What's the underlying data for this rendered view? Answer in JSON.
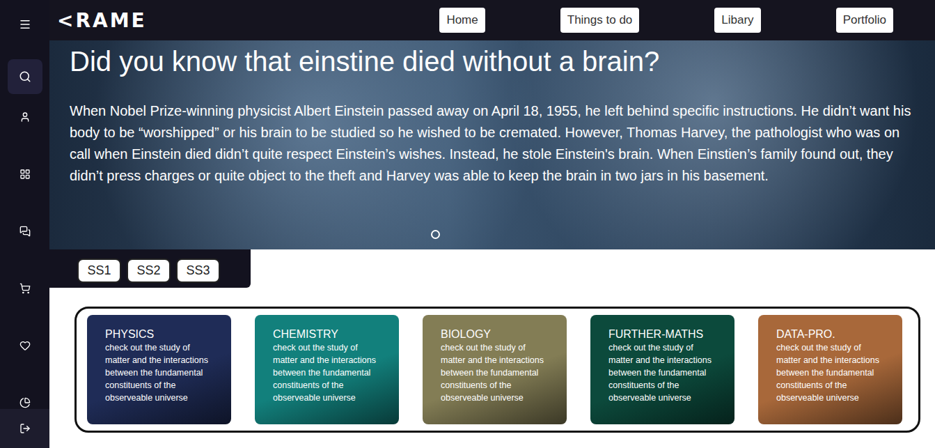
{
  "logo": "<RAME",
  "nav": [
    {
      "label": "Home"
    },
    {
      "label": "Things to do"
    },
    {
      "label": "Libary"
    },
    {
      "label": "Portfolio"
    }
  ],
  "sidebar": {
    "items": [
      {
        "selected": true
      },
      {
        "selected": false
      },
      {
        "selected": false
      },
      {
        "selected": false
      },
      {
        "selected": false
      },
      {
        "selected": false
      },
      {
        "selected": false
      }
    ]
  },
  "hero": {
    "title": "Did you know that einstine died without a brain?",
    "text": "When Nobel Prize-winning physicist Albert Einstein passed away on April 18, 1955, he left behind specific instructions. He didn’t want his body to be “worshipped” or his brain to be studied so he wished to be cremated. However, Thomas Harvey, the pathologist who was on call when Einstein died didn’t quite respect Einstein’s wishes. Instead, he stole Einstein's brain. When Einstien’s family found out, they didn’t press charges or quite object to the theft and Harvey was able to keep the brain in two jars in his basement.",
    "slides": [
      {
        "selected": true
      }
    ]
  },
  "levels": [
    {
      "label": "SS1",
      "selected": false
    },
    {
      "label": "SS2",
      "selected": false
    },
    {
      "label": "SS3",
      "selected": false
    }
  ],
  "subjects": [
    {
      "title": "PHYSICS",
      "text": "check out the study of matter and the interactions between the fundamental constituents of the observeable universe",
      "color": "#1f2c57"
    },
    {
      "title": "CHEMISTRY",
      "text": "check out the study of matter and the interactions between the fundamental constituents of the observeable universe",
      "color": "#12807c"
    },
    {
      "title": "BIOLOGY",
      "text": "check out the study of matter and the interactions between the fundamental constituents of the observeable universe",
      "color": "#837d55"
    },
    {
      "title": "FURTHER-MATHS",
      "text": "check out the study of matter and the interactions between the fundamental constituents of the observeable universe",
      "color": "#0c4a3c"
    },
    {
      "title": "DATA-PRO.",
      "text": "check out the study of matter and the interactions between the fundamental constituents of the observeable universe",
      "color": "#a8683a"
    }
  ]
}
